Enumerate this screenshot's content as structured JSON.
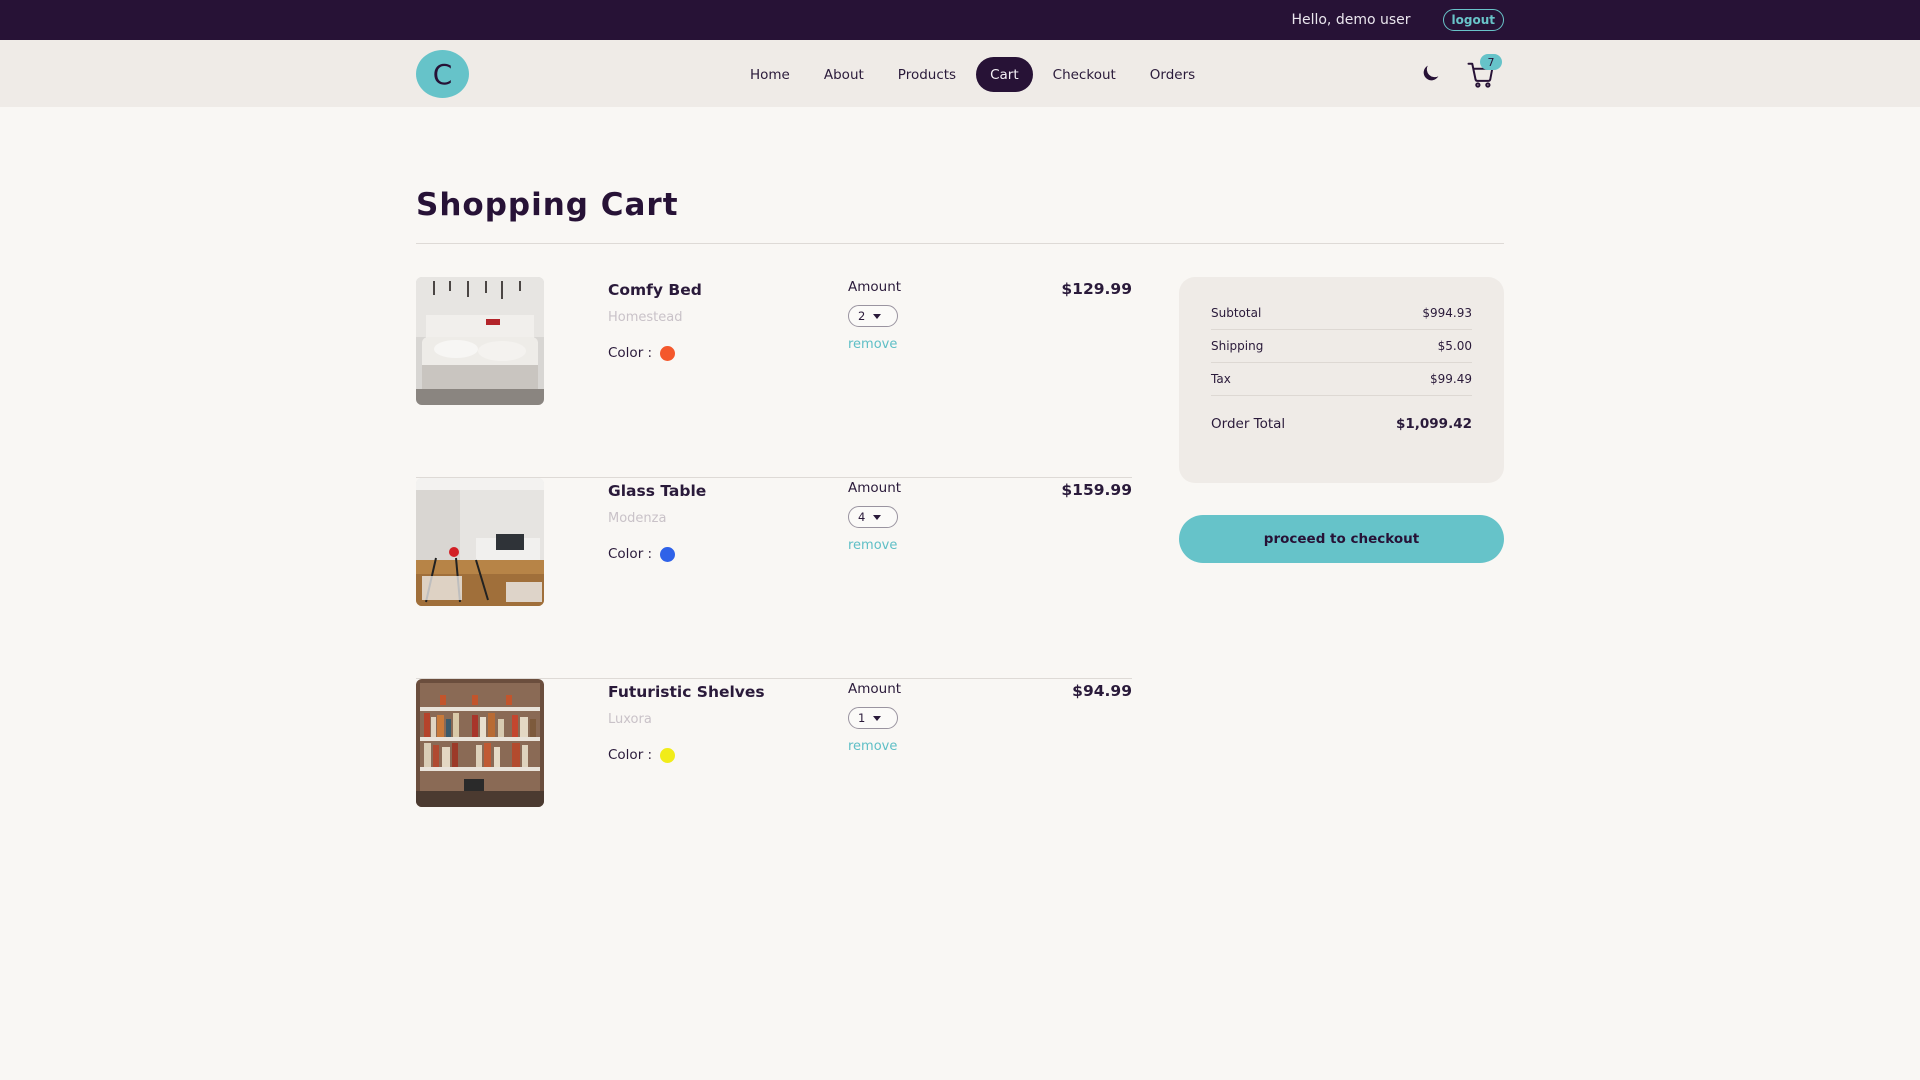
{
  "topbar": {
    "greeting": "Hello, demo user",
    "logout_label": "logout"
  },
  "nav": {
    "logo_letter": "C",
    "links": [
      {
        "label": "Home",
        "active": false
      },
      {
        "label": "About",
        "active": false
      },
      {
        "label": "Products",
        "active": false
      },
      {
        "label": "Cart",
        "active": true
      },
      {
        "label": "Checkout",
        "active": false
      },
      {
        "label": "Orders",
        "active": false
      }
    ],
    "cart_count": "7",
    "theme_icon": "moon-icon",
    "cart_icon": "cart-icon"
  },
  "page": {
    "title": "Shopping Cart"
  },
  "items": [
    {
      "name": "Comfy Bed",
      "brand": "Homestead",
      "color_label": "Color :",
      "color": "#f4582c",
      "amount_label": "Amount",
      "amount": "2",
      "remove_label": "remove",
      "price": "$129.99"
    },
    {
      "name": "Glass Table",
      "brand": "Modenza",
      "color_label": "Color :",
      "color": "#2f62e8",
      "amount_label": "Amount",
      "amount": "4",
      "remove_label": "remove",
      "price": "$159.99"
    },
    {
      "name": "Futuristic Shelves",
      "brand": "Luxora",
      "color_label": "Color :",
      "color": "#f1ec19",
      "amount_label": "Amount",
      "amount": "1",
      "remove_label": "remove",
      "price": "$94.99"
    }
  ],
  "summary": {
    "rows": [
      {
        "label": "Subtotal",
        "value": "$994.93"
      },
      {
        "label": "Shipping",
        "value": "$5.00"
      },
      {
        "label": "Tax",
        "value": "$99.49"
      }
    ],
    "total_label": "Order Total",
    "total_value": "$1,099.42",
    "checkout_label": "proceed to checkout"
  },
  "colors": {
    "brand_dark": "#271236",
    "accent": "#66c3c9"
  }
}
